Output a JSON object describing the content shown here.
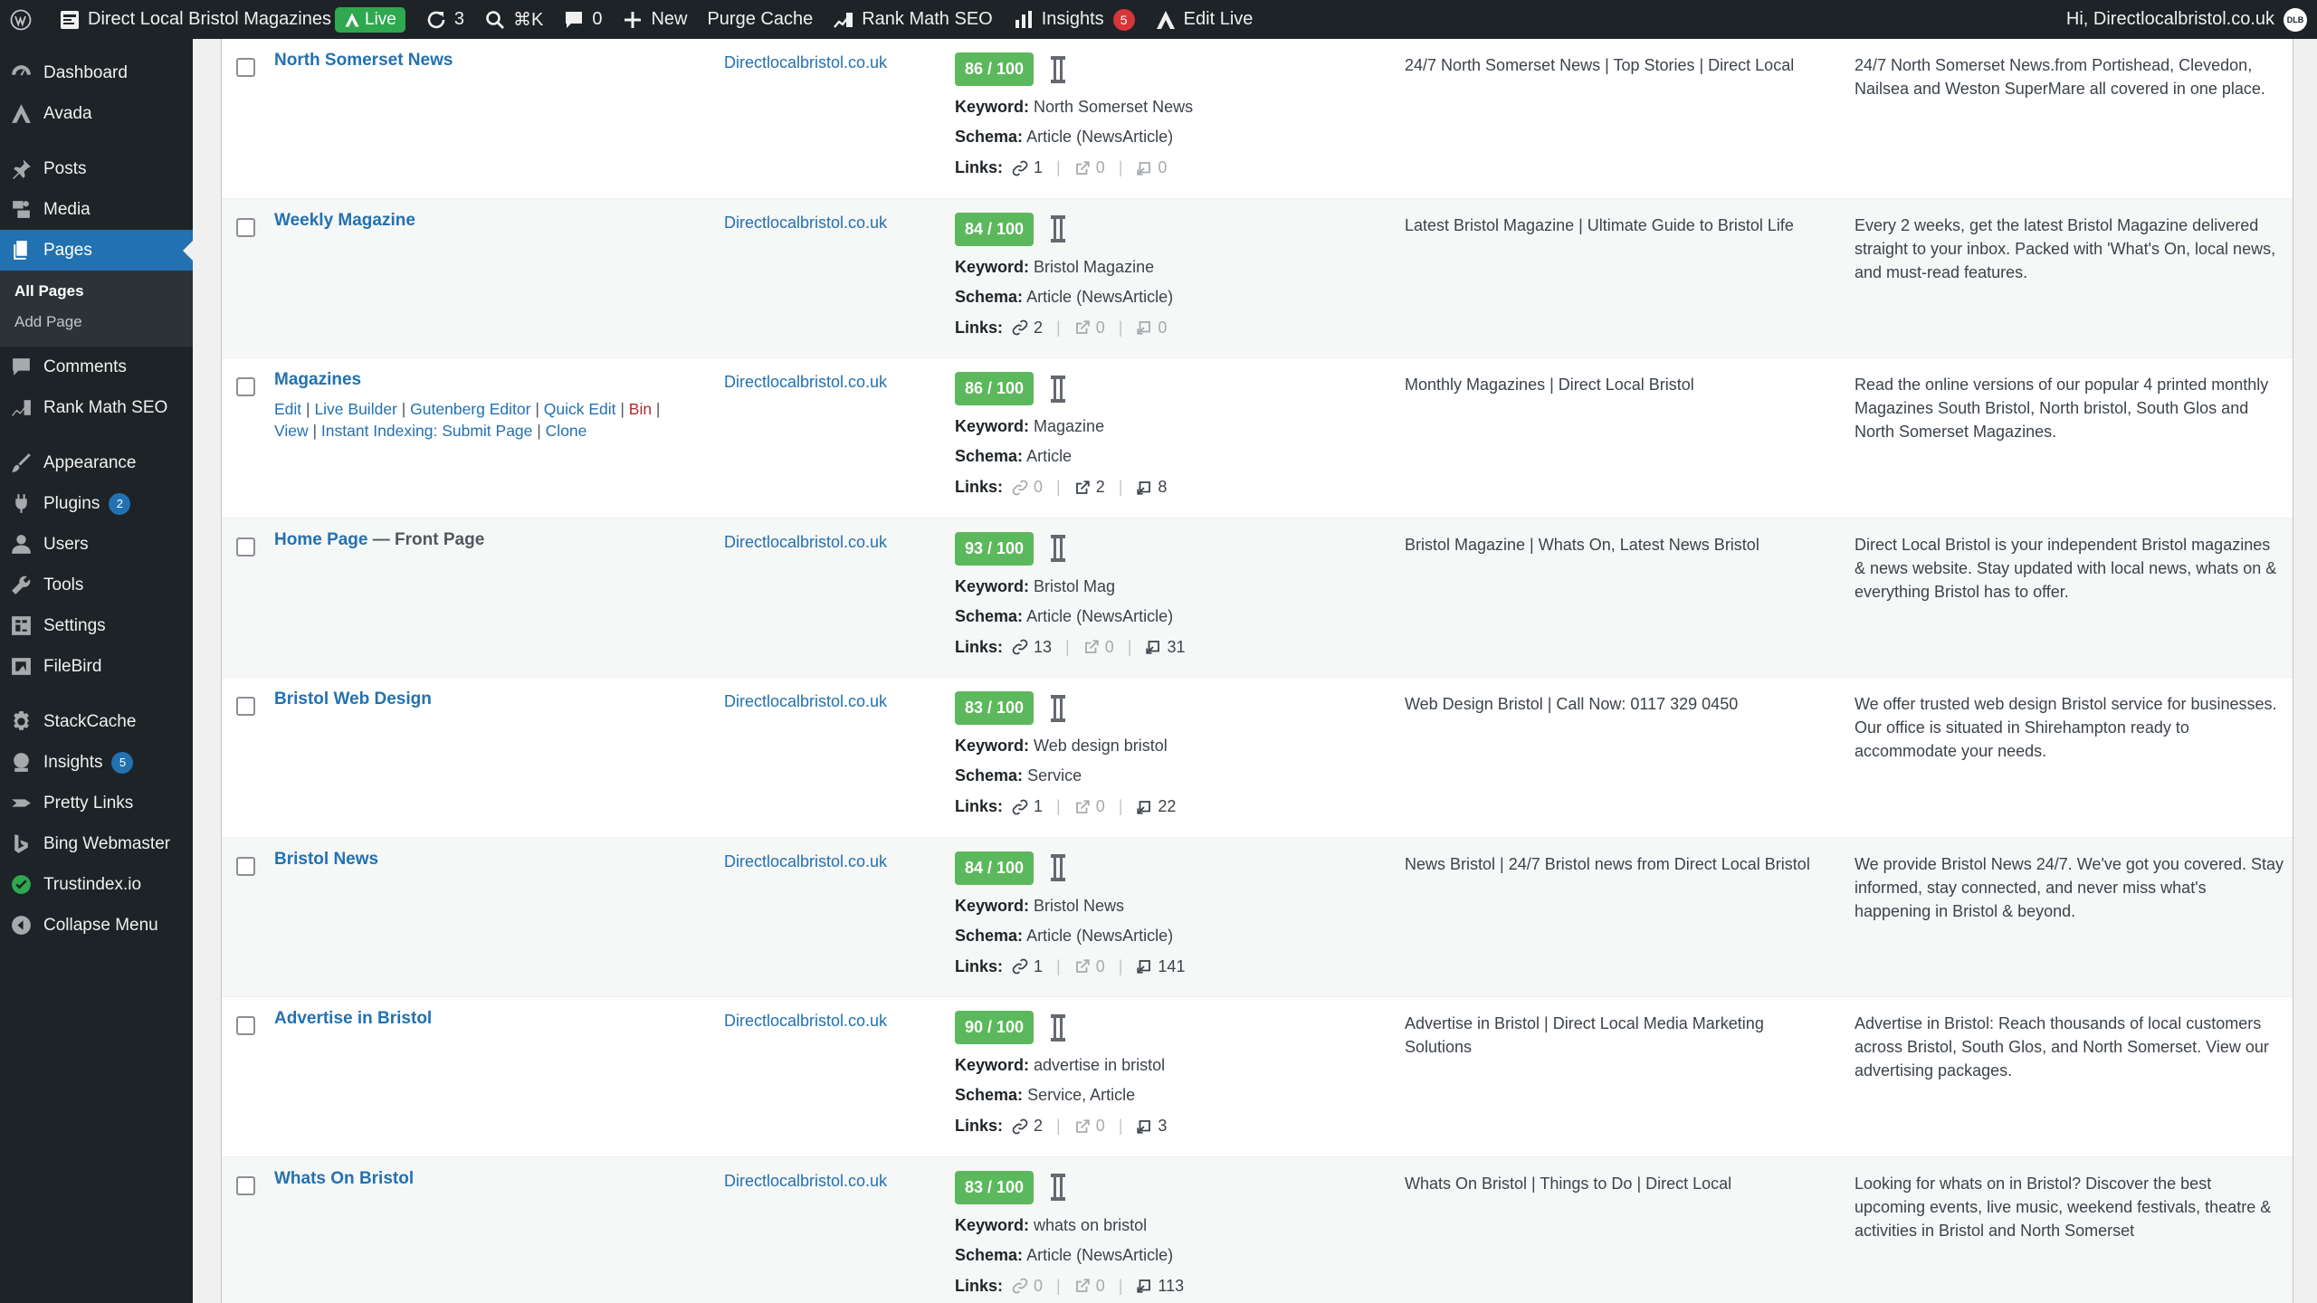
{
  "adminbar": {
    "site_name": "Direct Local Bristol Magazines",
    "live_label": "Live",
    "updates_count": "3",
    "command_shortcut": "⌘K",
    "comments_count": "0",
    "new_label": "New",
    "purge_cache_label": "Purge Cache",
    "rank_math_label": "Rank Math SEO",
    "insights_label": "Insights",
    "insights_badge": "5",
    "edit_live_label": "Edit Live",
    "greeting": "Hi, Directlocalbristol.co.uk",
    "avatar_text": "DLB"
  },
  "menu": {
    "dashboard": "Dashboard",
    "avada": "Avada",
    "posts": "Posts",
    "media": "Media",
    "pages": "Pages",
    "all_pages": "All Pages",
    "add_page": "Add Page",
    "comments": "Comments",
    "rank_math": "Rank Math SEO",
    "appearance": "Appearance",
    "plugins": "Plugins",
    "plugins_badge": "2",
    "users": "Users",
    "tools": "Tools",
    "settings": "Settings",
    "filebird": "FileBird",
    "stackcache": "StackCache",
    "insights": "Insights",
    "insights_badge": "5",
    "pretty_links": "Pretty Links",
    "bing_webmaster": "Bing Webmaster",
    "trustindex": "Trustindex.io",
    "collapse": "Collapse Menu"
  },
  "labels": {
    "keyword": "Keyword:",
    "schema": "Schema:",
    "links": "Links:",
    "front_page": " — Front Page"
  },
  "row_actions": {
    "edit": "Edit",
    "live_builder": "Live Builder",
    "gutenberg": "Gutenberg Editor",
    "quick_edit": "Quick Edit",
    "bin": "Bin",
    "view": "View",
    "instant_indexing": "Instant Indexing: Submit Page",
    "clone": "Clone"
  },
  "rows": [
    {
      "title": "North Somerset News",
      "site": "Directlocalbristol.co.uk",
      "score": "86 / 100",
      "keyword": "North Somerset News",
      "schema": "Article (NewsArticle)",
      "internal": "1",
      "external": "0",
      "incoming": "0",
      "seo_title": "24/7 North Somerset News | Top Stories | Direct Local",
      "description": "24/7 North Somerset News.from Portishead, Clevedon, Nailsea and Weston SuperMare all covered in one place."
    },
    {
      "title": "Weekly Magazine",
      "site": "Directlocalbristol.co.uk",
      "score": "84 / 100",
      "keyword": "Bristol Magazine",
      "schema": "Article (NewsArticle)",
      "internal": "2",
      "external": "0",
      "incoming": "0",
      "seo_title": "Latest Bristol Magazine | Ultimate Guide to Bristol Life",
      "description": "Every 2 weeks, get the latest Bristol Magazine delivered straight to your inbox. Packed with 'What's On, local news, and must-read features."
    },
    {
      "title": "Magazines",
      "site": "Directlocalbristol.co.uk",
      "score": "86 / 100",
      "keyword": "Magazine",
      "schema": "Article",
      "internal": "0",
      "external": "2",
      "incoming": "8",
      "seo_title": "Monthly Magazines | Direct Local Bristol",
      "description": "Read the online versions of our popular 4 printed monthly Magazines South Bristol, North bristol, South Glos and North Somerset Magazines."
    },
    {
      "title": "Home Page",
      "site": "Directlocalbristol.co.uk",
      "score": "93 / 100",
      "keyword": "Bristol Mag",
      "schema": "Article (NewsArticle)",
      "internal": "13",
      "external": "0",
      "incoming": "31",
      "seo_title": "Bristol Magazine | Whats On, Latest News Bristol",
      "description": "Direct Local Bristol is your independent Bristol magazines & news website. Stay updated with local news, whats on & everything Bristol has to offer."
    },
    {
      "title": "Bristol Web Design",
      "site": "Directlocalbristol.co.uk",
      "score": "83 / 100",
      "keyword": "Web design bristol",
      "schema": "Service",
      "internal": "1",
      "external": "0",
      "incoming": "22",
      "seo_title": "Web Design Bristol | Call Now: 0117 329 0450",
      "description": "We offer trusted web design Bristol service for businesses. Our office is situated in Shirehampton ready to accommodate your needs."
    },
    {
      "title": "Bristol News",
      "site": "Directlocalbristol.co.uk",
      "score": "84 / 100",
      "keyword": "Bristol News",
      "schema": "Article (NewsArticle)",
      "internal": "1",
      "external": "0",
      "incoming": "141",
      "seo_title": "News Bristol | 24/7 Bristol news from Direct Local Bristol",
      "description": "We provide Bristol News 24/7. We've got you covered. Stay informed, stay connected, and never miss what's happening in Bristol & beyond."
    },
    {
      "title": "Advertise in Bristol",
      "site": "Directlocalbristol.co.uk",
      "score": "90 / 100",
      "keyword": "advertise in bristol",
      "schema": "Service, Article",
      "internal": "2",
      "external": "0",
      "incoming": "3",
      "seo_title": "Advertise in Bristol | Direct Local Media Marketing Solutions",
      "description": "Advertise in Bristol: Reach thousands of local customers across Bristol, South Glos, and North Somerset. View our advertising packages."
    },
    {
      "title": "Whats On Bristol",
      "site": "Directlocalbristol.co.uk",
      "score": "83 / 100",
      "keyword": "whats on bristol",
      "schema": "Article (NewsArticle)",
      "internal": "0",
      "external": "0",
      "incoming": "113",
      "seo_title": "Whats On Bristol | Things to Do | Direct Local",
      "description": "Looking for whats on in Bristol? Discover the best upcoming events, live music, weekend festivals, theatre & activities in Bristol and North Somerset"
    }
  ]
}
